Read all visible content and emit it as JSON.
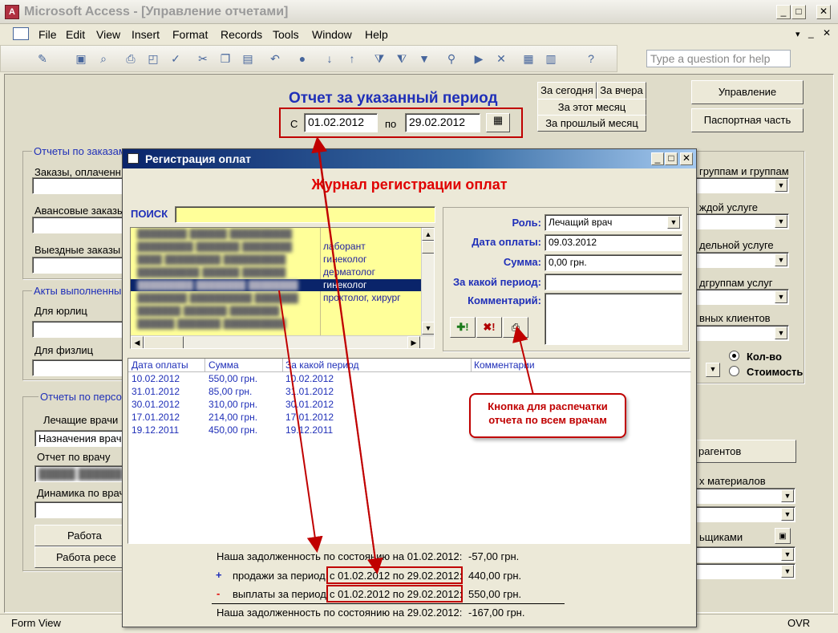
{
  "app": {
    "title": "Microsoft Access - [Управление отчетами]",
    "ask_placeholder": "Type a question for help"
  },
  "menu": [
    "File",
    "Edit",
    "View",
    "Insert",
    "Format",
    "Records",
    "Tools",
    "Window",
    "Help"
  ],
  "status": {
    "left": "Form View",
    "right": "OVR"
  },
  "report": {
    "title": "Отчет за указанный период",
    "from_label": "С",
    "from_value": "01.02.2012",
    "to_label": "по",
    "to_value": "29.02.2012",
    "btn_today": "За сегодня",
    "btn_yesterday": "За вчера",
    "btn_this_month": "За этот месяц",
    "btn_last_month": "За прошлый месяц",
    "btn_manage": "Управление",
    "btn_passport": "Паспортная часть"
  },
  "background_form": {
    "group1": "Отчеты по заказам",
    "g1_l1": "Заказы, оплаченн",
    "g1_l2": "Авансовые заказы",
    "g1_l3": "Выездные заказы",
    "group2": "Акты выполненны",
    "g2_l1": "Для юрлиц",
    "g2_l2": "Для физлиц",
    "group3": "Отчеты по персо",
    "g3_l1": "Лечащие врачи",
    "g3_combo": "Назначения врач",
    "g3_l2": "Отчет по врачу",
    "g3_l3": "Динамика по врач",
    "g3_btn1": "Работа",
    "g3_btn2": "Работа ресе",
    "right_l1": "группам и группам",
    "right_l2": "ждой услуге",
    "right_l3": "дельной услуге",
    "right_l4": "дгруппам услуг",
    "right_l5": "вных клиентов",
    "radio1": "Кол-во",
    "radio2": "Стоимость",
    "right_btn": "рагентов",
    "right_l6": "х материалов",
    "right_l7": "ьщиками"
  },
  "dialog": {
    "title": "Регистрация оплат",
    "heading": "Журнал регистрации оплат",
    "search_label": "ПОИСК",
    "specialties": [
      "лаборант",
      "гинеколог",
      "дерматолог",
      "гинеколог",
      "проктолог, хирург"
    ],
    "role_label": "Роль:",
    "role_value": "Лечащий врач",
    "date_label": "Дата оплаты:",
    "date_value": "09.03.2012",
    "sum_label": "Сумма:",
    "sum_value": "0,00 грн.",
    "period_label": "За какой период:",
    "comment_label": "Комментарий:",
    "table_headers": [
      "Дата оплаты",
      "Сумма",
      "За какой период",
      "Комментарии"
    ],
    "rows": [
      {
        "date": "10.02.2012",
        "sum": "550,00 грн.",
        "period": "10.02.2012"
      },
      {
        "date": "31.01.2012",
        "sum": "85,00 грн.",
        "period": "31.01.2012"
      },
      {
        "date": "30.01.2012",
        "sum": "310,00 грн.",
        "period": "30.01.2012"
      },
      {
        "date": "17.01.2012",
        "sum": "214,00 грн.",
        "period": "17.01.2012"
      },
      {
        "date": "19.12.2011",
        "sum": "450,00 грн.",
        "period": "19.12.2011"
      }
    ],
    "bal_start": "Наша задолженность по состоянию на 01.02.2012:",
    "bal_start_val": "-57,00 грн.",
    "plus_sign": "+",
    "sales_label": "продажи за период",
    "sales_range": "с 01.02.2012 по 29.02.2012:",
    "sales_val": "440,00 грн.",
    "minus_sign": "-",
    "pay_label": "выплаты за период",
    "pay_range": "с 01.02.2012 по 29.02.2012:",
    "pay_val": "550,00 грн.",
    "bal_end": "Наша задолженность по состоянию на 29.02.2012:",
    "bal_end_val": "-167,00 грн."
  },
  "callout": {
    "line1": "Кнопка для распечатки",
    "line2": "отчета по всем врачам"
  },
  "colors": {
    "annotation": "#c00000",
    "label_blue": "#1f2fb8",
    "list_yellow": "#ffff99"
  }
}
